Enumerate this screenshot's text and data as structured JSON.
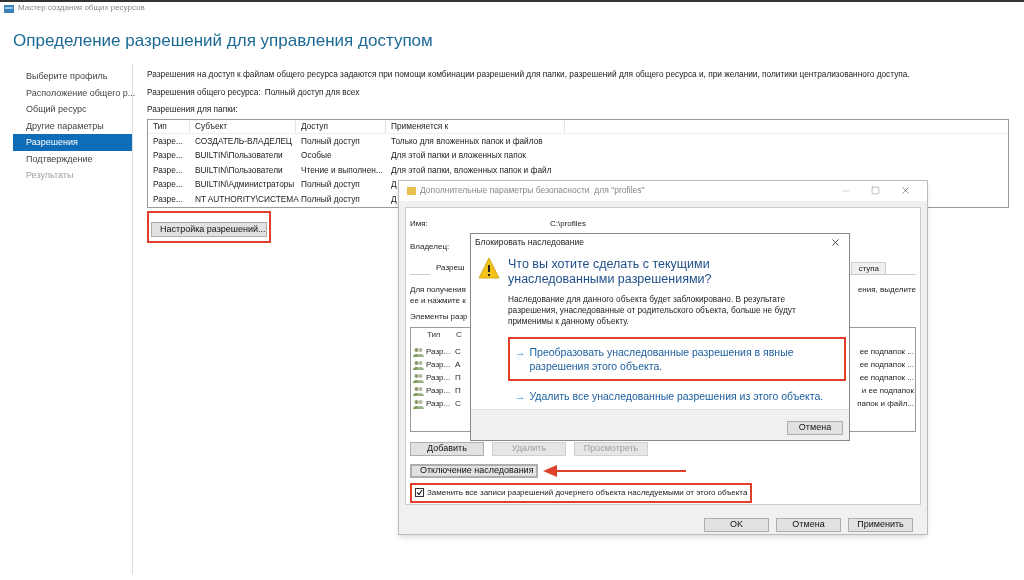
{
  "window": {
    "title": "Мастер создания общих ресурсов"
  },
  "heading": "Определение разрешений для управления доступом",
  "sidebar": {
    "items": [
      {
        "label": "Выберите профиль",
        "selected": false,
        "disabled": false
      },
      {
        "label": "Расположение общего р...",
        "selected": false,
        "disabled": false
      },
      {
        "label": "Общий ресурс",
        "selected": false,
        "disabled": false
      },
      {
        "label": "Другие параметры",
        "selected": false,
        "disabled": false
      },
      {
        "label": "Разрешения",
        "selected": true,
        "disabled": false
      },
      {
        "label": "Подтверждение",
        "selected": false,
        "disabled": false
      },
      {
        "label": "Результаты",
        "selected": false,
        "disabled": true
      }
    ]
  },
  "content": {
    "description": "Разрешения на доступ к файлам общего ресурса задаются при помощи комбинации разрешений для папки, разрешений для общего ресурса и, при желании, политики централизованного доступа.",
    "share_permissions": {
      "label": "Разрешения общего ресурса:",
      "value": "Полный доступ для всех"
    },
    "folder_permissions_label": "Разрешения для папки:",
    "table": {
      "columns": [
        "Тип",
        "Субъект",
        "Доступ",
        "Применяется к"
      ],
      "rows": [
        [
          "Разре...",
          "СОЗДАТЕЛЬ-ВЛАДЕЛЕЦ",
          "Полный доступ",
          "Только для вложенных папок и файлов"
        ],
        [
          "Разре...",
          "BUILTIN\\Пользователи",
          "Особые",
          "Для этой папки и вложенных папок"
        ],
        [
          "Разре...",
          "BUILTIN\\Пользователи",
          "Чтение и выполнен...",
          "Для этой папки, вложенных папок и файл"
        ],
        [
          "Разре...",
          "BUILTIN\\Администраторы",
          "Полный доступ",
          "Д"
        ],
        [
          "Разре...",
          "NT AUTHORITY\\СИСТЕМА",
          "Полный доступ",
          "Д"
        ]
      ]
    },
    "customize_button": {
      "label": "Настройка разрешений...",
      "highlighted": true
    }
  },
  "security_dialog": {
    "title": "Дополнительные параметры безопасности  для \"profiles\"",
    "name_label": "Имя:",
    "name_value": "C:\\profiles",
    "owner_label": "Владелец:",
    "tabs": [
      {
        "label": "Разреш",
        "selected": true
      },
      {
        "label": "ступа",
        "selected": false
      }
    ],
    "info_lines": [
      {
        "left": "Для получения",
        "right": "ения, выделите"
      },
      {
        "left": "ее и нажмите к"
      }
    ],
    "entries_label": "Элементы разр",
    "list": {
      "columns": [
        "Тип",
        "С"
      ],
      "rows": [
        {
          "type": "Разр...",
          "principal": "С",
          "applies": "ее подпапок ..."
        },
        {
          "type": "Разр...",
          "principal": "А",
          "applies": "ее подпапок ..."
        },
        {
          "type": "Разр...",
          "principal": "П",
          "applies": "ее подпапок ..."
        },
        {
          "type": "Разр...",
          "principal": "П",
          "applies": "и ее подпапок"
        },
        {
          "type": "Разр...",
          "principal": "С",
          "applies": "папок и файл..."
        }
      ]
    },
    "buttons": [
      {
        "label": "Добавить",
        "disabled": false
      },
      {
        "label": "Удалить",
        "disabled": true
      },
      {
        "label": "Просмотреть",
        "disabled": true
      }
    ],
    "disable_inheritance": {
      "label": "Отключение наследования",
      "focused": true
    },
    "replace_checkbox": {
      "label": "Заменить все записи разрешений дочернего объекта наследуемыми от этого объекта",
      "checked": true,
      "highlighted": true
    },
    "footer_buttons": [
      "OK",
      "Отмена",
      "Применить"
    ]
  },
  "block_dialog": {
    "title": "Блокировать наследование",
    "question": "Что вы хотите сделать с текущими унаследованными разрешениями?",
    "message": "Наследование для данного объекта будет заблокировано. В результате разрешения, унаследованные от родительского объекта, больше не будут применимы к данному объекту.",
    "options": [
      {
        "arrow": "→",
        "label": "Преобразовать унаследованные разрешения в явные разрешения этого объекта.",
        "highlighted": true
      },
      {
        "arrow": "→",
        "label": "Удалить все унаследованные разрешения из этого объекта.",
        "highlighted": false
      }
    ],
    "cancel_button": "Отмена"
  }
}
